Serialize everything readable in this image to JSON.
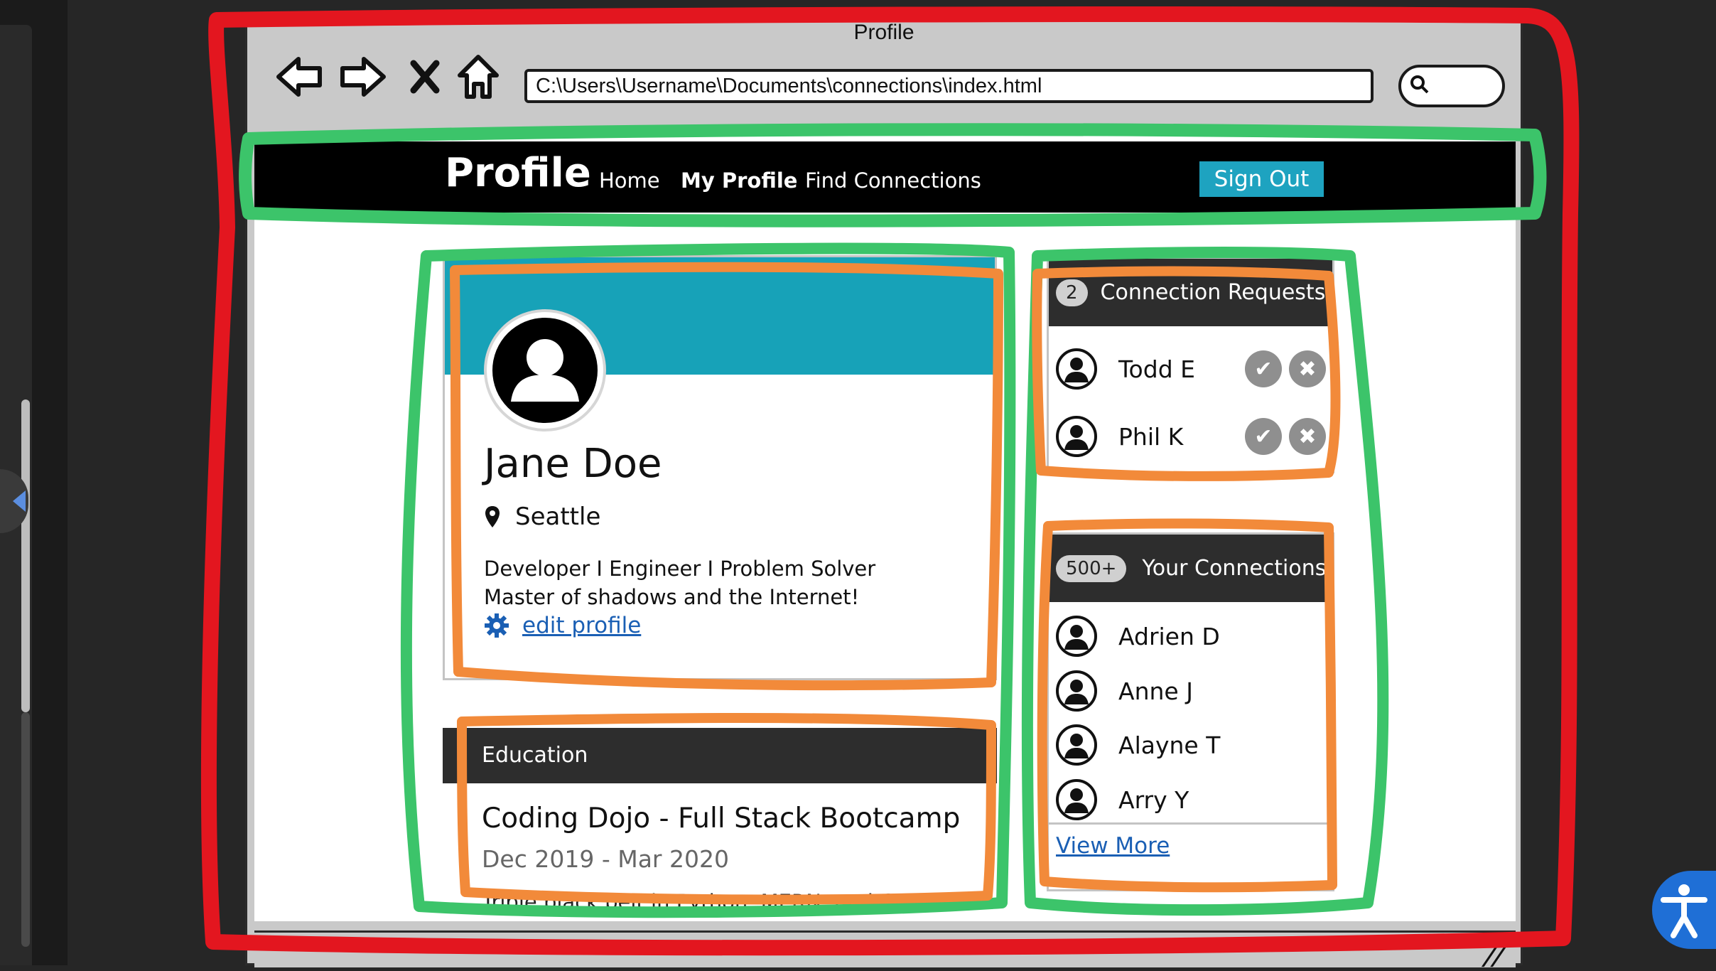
{
  "window": {
    "title": "Profile",
    "address": "C:\\Users\\Username\\Documents\\connections\\index.html"
  },
  "toolbar": {
    "icons": [
      "back-arrow-icon",
      "forward-arrow-icon",
      "close-x-icon",
      "home-icon",
      "search-icon"
    ]
  },
  "navbar": {
    "brand": "Profile",
    "links": [
      "Home",
      "My Profile",
      "Find Connections"
    ],
    "active_link": "My Profile",
    "sign_out": "Sign Out"
  },
  "profile": {
    "name": "Jane Doe",
    "location": "Seattle",
    "bio_line1": "Developer I Engineer I Problem Solver",
    "bio_line2": "Master of shadows and the Internet!",
    "edit_label": "edit profile"
  },
  "education": {
    "header": "Education",
    "title": "Coding Dojo - Full Stack Bootcamp",
    "dates": "Dec 2019 - Mar 2020",
    "description": "Triple black belt in Python, MERN, and C#..."
  },
  "requests": {
    "count": "2",
    "header": "Connection Requests",
    "items": [
      {
        "name": "Todd E"
      },
      {
        "name": "Phil K"
      }
    ]
  },
  "connections": {
    "count": "500+",
    "header": "Your Connections",
    "items": [
      {
        "name": "Adrien D"
      },
      {
        "name": "Anne J"
      },
      {
        "name": "Alayne T"
      },
      {
        "name": "Arry Y"
      }
    ],
    "view_more": "View More"
  },
  "colors": {
    "accent": "#17a2b8",
    "navbar": "#000000",
    "header_dark": "#2d2d2d",
    "link": "#1a5fb4",
    "annotation_red": "#e3161f",
    "annotation_green": "#3cc46a",
    "annotation_orange": "#f28a3a"
  }
}
